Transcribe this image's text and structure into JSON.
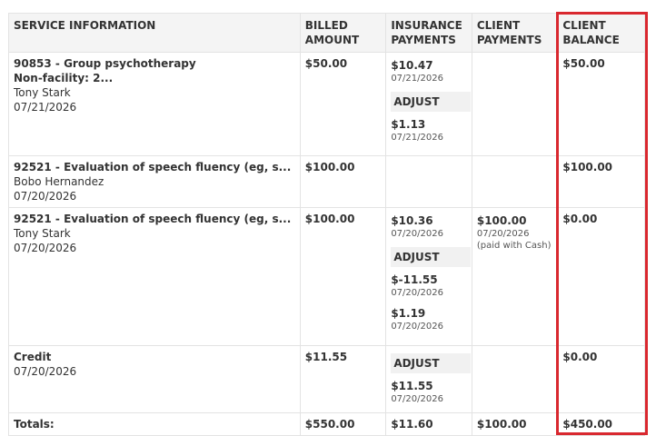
{
  "headers": {
    "service": "SERVICE INFORMATION",
    "billed": [
      "BILLED",
      "AMOUNT"
    ],
    "insurance": [
      "INSURANCE",
      "PAYMENTS"
    ],
    "client_payments": [
      "CLIENT",
      "PAYMENTS"
    ],
    "client_balance": [
      "CLIENT",
      "BALANCE"
    ]
  },
  "rows": [
    {
      "title": "90853 - Group psychotherapy",
      "subtitle": "Non-facility: 2...",
      "person": "Tony Stark",
      "date": "07/21/2026",
      "billed": "$50.00",
      "ins_payment": {
        "amount": "$10.47",
        "date": "07/21/2026"
      },
      "adjust_label": "ADJUST",
      "adjustments": [
        {
          "amount": "$1.13",
          "date": "07/21/2026"
        }
      ],
      "balance": "$50.00"
    },
    {
      "title": "92521 - Evaluation of speech fluency (eg, s...",
      "person": "Bobo Hernandez",
      "date": "07/20/2026",
      "billed": "$100.00",
      "balance": "$100.00"
    },
    {
      "title": "92521 - Evaluation of speech fluency (eg, s...",
      "person": "Tony Stark",
      "date": "07/20/2026",
      "billed": "$100.00",
      "ins_payment": {
        "amount": "$10.36",
        "date": "07/20/2026"
      },
      "adjust_label": "ADJUST",
      "adjustments": [
        {
          "amount": "$-11.55",
          "date": "07/20/2026"
        },
        {
          "amount": "$1.19",
          "date": "07/20/2026"
        }
      ],
      "client_payment": {
        "amount": "$100.00",
        "date": "07/20/2026",
        "note": "(paid with Cash)"
      },
      "balance": "$0.00"
    },
    {
      "title": "Credit",
      "date": "07/20/2026",
      "billed": "$11.55",
      "adjust_label": "ADJUST",
      "adjustments": [
        {
          "amount": "$11.55",
          "date": "07/20/2026"
        }
      ],
      "balance": "$0.00"
    }
  ],
  "totals": {
    "label": "Totals:",
    "billed": "$550.00",
    "insurance": "$11.60",
    "client_payments": "$100.00",
    "client_balance": "$450.00"
  },
  "highlight_color": "#d9282f"
}
